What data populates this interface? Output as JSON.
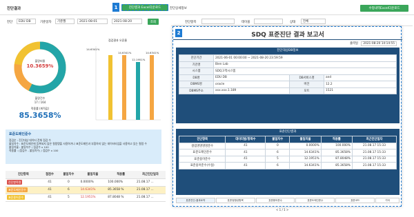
{
  "top": {
    "title": "진단결과",
    "btn_excel": "진단결과 Excel다운로드",
    "detail_label": "진단상세정보",
    "btn_right": "수정내역Excel다운로드",
    "badge1": "1"
  },
  "filters": {
    "db_label": "진단",
    "db_value": "EDU DB",
    "date_label": "기준일자",
    "date_type": "기준월",
    "start": "2021-08-01",
    "end": "2021-08-20",
    "search": "조회"
  },
  "donut": {
    "bad_label": "불량비율",
    "bad_value": "10.3659%",
    "count_label": "불량건수",
    "count_value": "17 / 164",
    "score_label": "적용률 (최적값)",
    "score_value": "85.3658%"
  },
  "bar": {
    "title": "점검결과 오류율",
    "labels": [
      "14.6341%",
      "14.6341%",
      "12.1951%",
      "14.6341%"
    ]
  },
  "info": {
    "title": "표준도메인준수",
    "lines": [
      "점검순 : 진단대상 데이터 전체 점검 수",
      "불일치수 : 표준도메인에 등록되지 않은 컬럼명을 사용하거나 표준도메인과 부합하지 않는 데이터타입을 사용하고 있는 컬럼 수",
      "불일치율 : 불일치수 / 점검수 x 100",
      "적용률 : (점검수 - 불일치수) / 점검수 x 100"
    ]
  },
  "ltable": {
    "headers": [
      "진단항목",
      "점검수",
      "불일치수",
      "불일치율",
      "적용률",
      "최근진단일자"
    ],
    "rows": [
      {
        "tag": "진단항목명",
        "c": "41",
        "m": "0",
        "r": "0.0000%",
        "a": "100.000%",
        "d": "21.08.17 ..."
      },
      {
        "tag": "표준도메인준수",
        "c": "41",
        "m": "6",
        "r": "14.6341%",
        "a": "85.3658 %",
        "d": "21.08.17 ..."
      },
      {
        "tag": "표준용어준수",
        "c": "41",
        "m": "5",
        "r": "12.1951%",
        "a": "87.8048 %",
        "d": "21.08.17 ..."
      }
    ]
  },
  "report": {
    "badge2": "2",
    "title": "SDQ 표준진단 결과 보고서",
    "print_label": "출력일",
    "print_date": "2021-08-20 14:14:55",
    "sec1": "진단대상DB정보",
    "period_label": "진단기간",
    "period_value": "2021-06-01 00:00:00 ~ 2021-08-20 23:59:59",
    "org_label": "기관명",
    "org_value": "Bien Lab",
    "sys_label": "시스템",
    "sys_value": "SDQ고객시스템",
    "db_label": "DB명",
    "db_value": "EDU DB",
    "dbsvc_label": "DB서비스명",
    "dbsvc_value": "and",
    "dbms_label": "DBMS명",
    "dbms_value": "oracle",
    "ver_label": "버전",
    "ver_value": "12.2",
    "ip_label": "DBMS주소",
    "ip_value": "xxx.xxx.1.189",
    "port_label": "포트",
    "port_value": "1521",
    "sec2": "표준진단결과",
    "headers": [
      "진단항목",
      "데이터발/항목수",
      "불일치수",
      "불일치율",
      "적용률",
      "최근진단일자"
    ],
    "rows": [
      [
        "컬럼명명명명준수",
        "41",
        "0",
        "0.0000%",
        "100.000%",
        "21.08.17 15:33"
      ],
      [
        "표준도메인준수",
        "41",
        "6",
        "14.6341%",
        "85.3658%",
        "21.08.17 15:33"
      ],
      [
        "표준용어준수",
        "41",
        "5",
        "12.1951%",
        "87.8048%",
        "21.08.17 15:33"
      ],
      [
        "표준용어준수(수정)",
        "41",
        "6",
        "14.6341%",
        "85.3658%",
        "21.08.17 15:33"
      ]
    ],
    "tabs": [
      "표준진단-결과요약",
      "표준정합성항목",
      "표준용어준수",
      "표준도메인준수",
      "표준코드",
      "기타"
    ],
    "pager": "< 1 / 1 >"
  },
  "mid": {
    "col1": "진단항목",
    "col1_value": "",
    "col2": "테이블",
    "col3": "상태",
    "col3_value": "전체"
  },
  "colors": {
    "green": "#3aa65a",
    "navy": "#1f4e7a",
    "orange": "#f5a642",
    "yellow": "#f1c232",
    "teal": "#23a5a8",
    "blue": "#1e7bd3"
  }
}
